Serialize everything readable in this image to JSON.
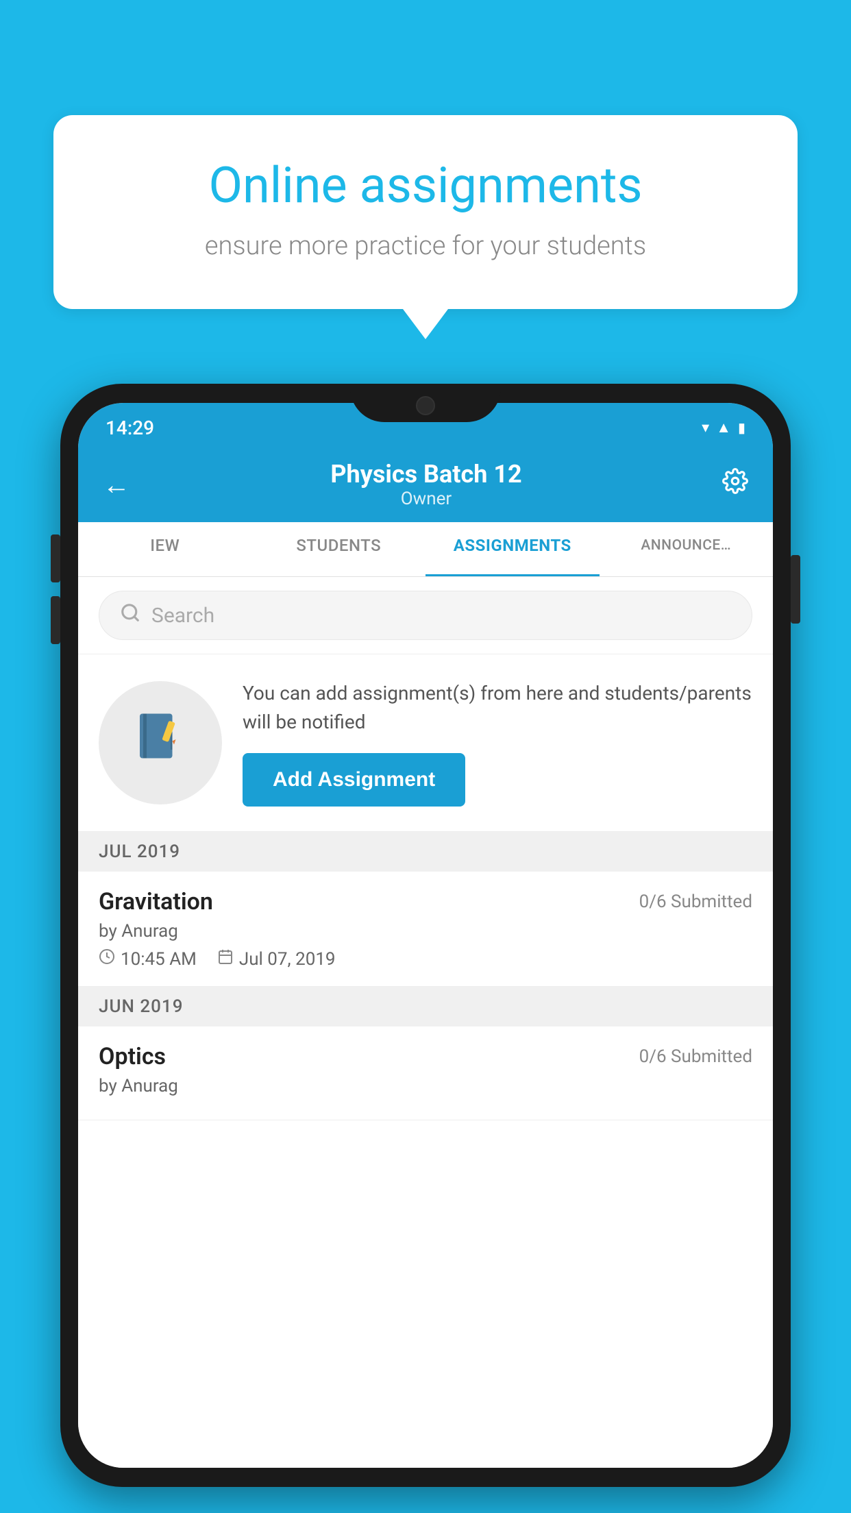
{
  "background_color": "#1db8e8",
  "bubble": {
    "title": "Online assignments",
    "subtitle": "ensure more practice for your students"
  },
  "phone": {
    "status_bar": {
      "time": "14:29"
    },
    "app_bar": {
      "title": "Physics Batch 12",
      "subtitle": "Owner",
      "back_label": "←",
      "settings_label": "⚙"
    },
    "tabs": [
      {
        "label": "IEW",
        "active": false
      },
      {
        "label": "STUDENTS",
        "active": false
      },
      {
        "label": "ASSIGNMENTS",
        "active": true
      },
      {
        "label": "ANNOUNCEMENTS",
        "active": false
      }
    ],
    "search": {
      "placeholder": "Search"
    },
    "cta": {
      "description": "You can add assignment(s) from here and students/parents will be notified",
      "button_label": "Add Assignment"
    },
    "sections": [
      {
        "header": "JUL 2019",
        "assignments": [
          {
            "name": "Gravitation",
            "submitted": "0/6 Submitted",
            "by": "by Anurag",
            "time": "10:45 AM",
            "date": "Jul 07, 2019"
          }
        ]
      },
      {
        "header": "JUN 2019",
        "assignments": [
          {
            "name": "Optics",
            "submitted": "0/6 Submitted",
            "by": "by Anurag",
            "time": "",
            "date": ""
          }
        ]
      }
    ]
  }
}
